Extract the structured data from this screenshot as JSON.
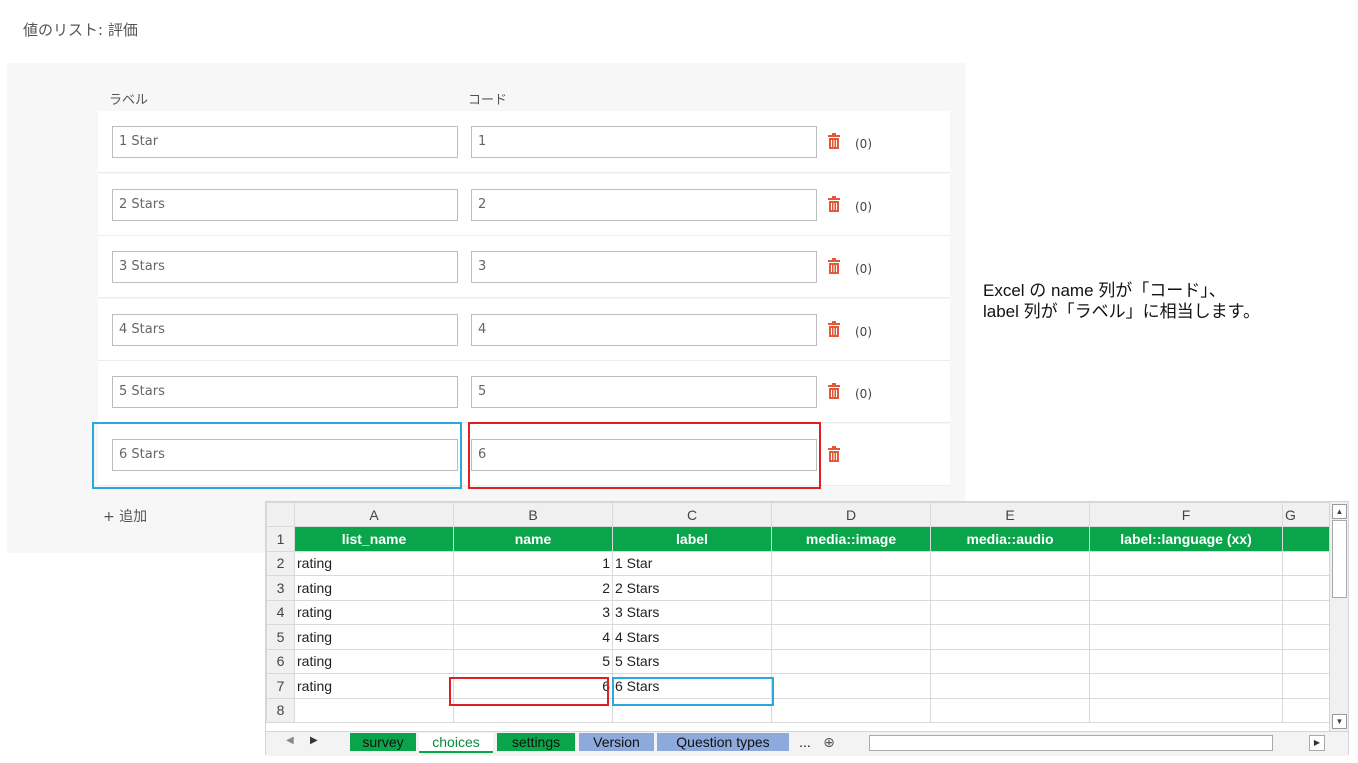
{
  "page": {
    "title": "値のリスト: 評価"
  },
  "form": {
    "label_header": "ラベル",
    "code_header": "コード",
    "rows": [
      {
        "label": "1 Star",
        "code": "1",
        "count": "(0)"
      },
      {
        "label": "2 Stars",
        "code": "2",
        "count": "(0)"
      },
      {
        "label": "3 Stars",
        "code": "3",
        "count": "(0)"
      },
      {
        "label": "4 Stars",
        "code": "4",
        "count": "(0)"
      },
      {
        "label": "5 Stars",
        "code": "5",
        "count": "(0)"
      },
      {
        "label": "6 Stars",
        "code": "6",
        "count": ""
      }
    ],
    "add_label": "+ 追加",
    "trash_color": "#e05a3a"
  },
  "note": {
    "line1": "Excel の name 列が「コード」、",
    "line2": "label 列が「ラベル」に相当します。"
  },
  "sheet": {
    "columns": [
      "A",
      "B",
      "C",
      "D",
      "E",
      "F",
      "G"
    ],
    "row_numbers": [
      "1",
      "2",
      "3",
      "4",
      "5",
      "6",
      "7",
      "8"
    ],
    "header_row": [
      "list_name",
      "name",
      "label",
      "media::image",
      "media::audio",
      "label::language (xx)",
      ""
    ],
    "header_color": "#0aa54a",
    "rows": [
      [
        "rating",
        "1",
        "1 Star"
      ],
      [
        "rating",
        "2",
        "2 Stars"
      ],
      [
        "rating",
        "3",
        "3 Stars"
      ],
      [
        "rating",
        "4",
        "4 Stars"
      ],
      [
        "rating",
        "5",
        "5 Stars"
      ],
      [
        "rating",
        "6",
        "6 Stars"
      ],
      [
        "",
        "",
        ""
      ]
    ],
    "tabs": [
      "survey",
      "choices",
      "settings",
      "Version",
      "Question types"
    ],
    "more_tabs": "...",
    "add_sheet": "⊕"
  }
}
